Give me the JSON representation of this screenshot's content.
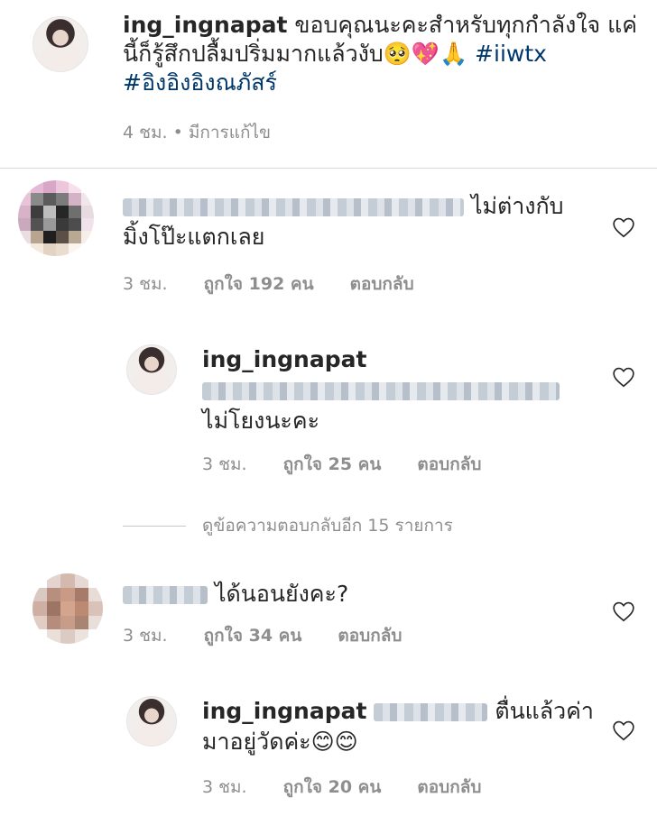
{
  "post": {
    "username": "ing_ingnapat",
    "caption": "ขอบคุณนะคะสำหรับทุกกำลังใจ แค่นี้ก็รู้สึกปลื้มปริ่มมากแล้วงับ🥺💖🙏",
    "hashtag1": "#iiwtx",
    "hashtag2": "#อิงอิงอิงณภัสร์",
    "time": "4 ชม.",
    "edited": "• มีการแก้ไข"
  },
  "comments": [
    {
      "text_line1": "ไม่ต่างกับ",
      "text_line2": "มิ้งโป๊ะแตกเลย",
      "time": "3 ชม.",
      "likes": "ถูกใจ 192 คน",
      "reply": "ตอบกลับ"
    },
    {
      "username": "ing_ingnapat",
      "text_line2": "ไม่โยงนะคะ",
      "time": "3 ชม.",
      "likes": "ถูกใจ 25 คน",
      "reply": "ตอบกลับ"
    },
    {
      "text": "ได้นอนยังคะ?",
      "time": "3 ชม.",
      "likes": "ถูกใจ 34 คน",
      "reply": "ตอบกลับ"
    },
    {
      "username": "ing_ingnapat",
      "text_line1": "ตื่นแล้วค่า",
      "text_line2": "มาอยู่วัดค่ะ😊😊",
      "time": "3 ชม.",
      "likes": "ถูกใจ 20 คน",
      "reply": "ตอบกลับ"
    }
  ],
  "view_replies": "ดูข้อความตอบกลับอีก 15 รายการ",
  "icons": {
    "heart": "heart-outline-icon"
  },
  "colors": {
    "meta": "#8e8e8e",
    "hashtag": "#00376b",
    "divider": "#dbdbdb"
  }
}
